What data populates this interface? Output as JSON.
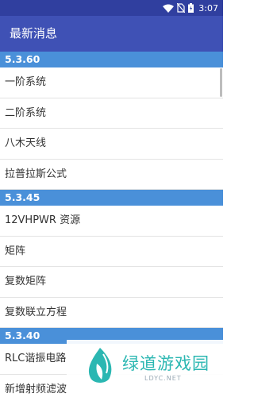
{
  "status_bar": {
    "time": "3:07"
  },
  "app_bar": {
    "title": "最新消息"
  },
  "sections": [
    {
      "version": "5.3.60",
      "items": [
        "一阶系统",
        "二阶系统",
        "八木天线",
        "拉普拉斯公式"
      ]
    },
    {
      "version": "5.3.45",
      "items": [
        "12VHPWR 资源",
        "矩阵",
        "复数矩阵",
        "复数联立方程"
      ]
    },
    {
      "version": "5.3.40",
      "items": [
        "RLC谐振电路",
        "新增射频滤波"
      ]
    }
  ],
  "watermark": {
    "name": "绿道游戏园",
    "domain": "LDYC.NET"
  },
  "colors": {
    "status_bar": "#303f9f",
    "app_bar": "#3f51b5",
    "section_header": "#4a90d9",
    "watermark": "#2bb7b2"
  }
}
